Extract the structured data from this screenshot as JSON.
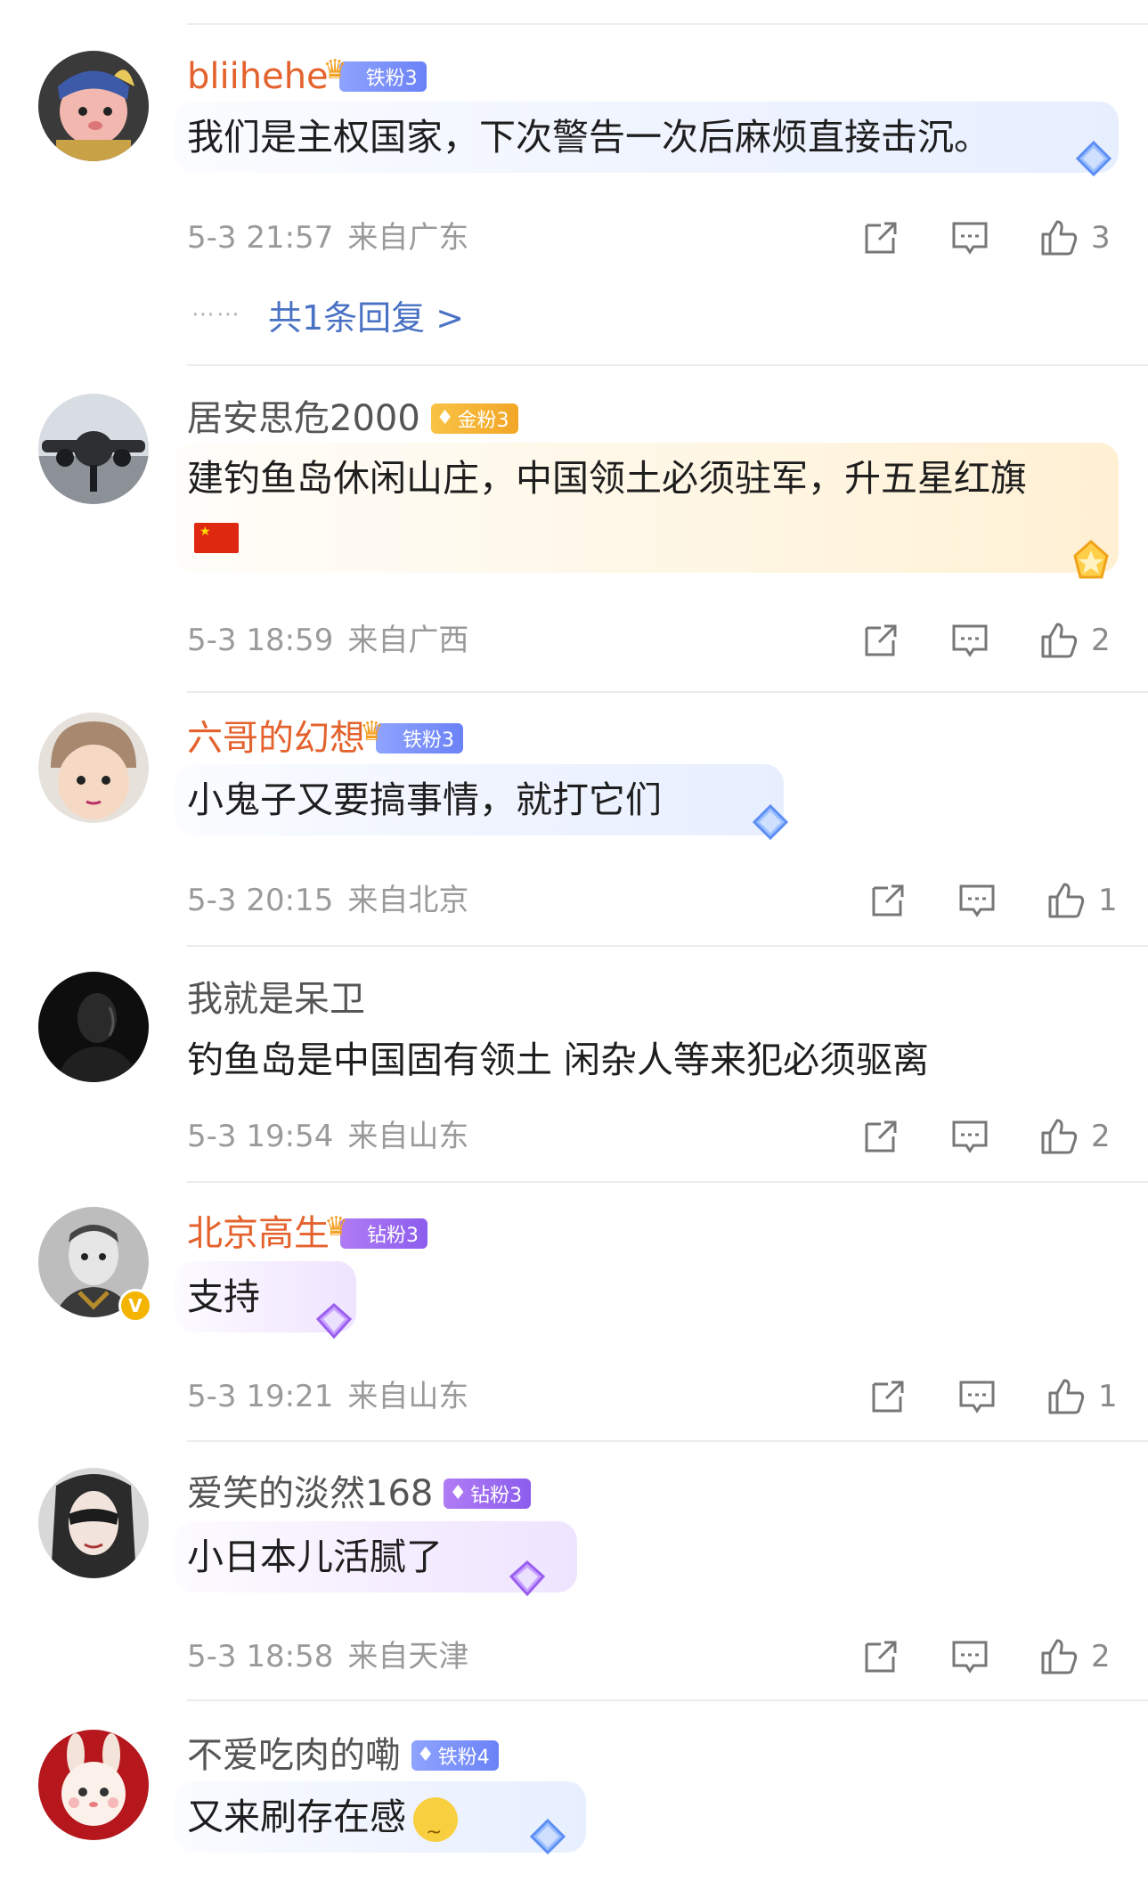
{
  "comments": [
    {
      "username": "bliihehe",
      "badge": "铁粉3",
      "badge_icon": "crown-icon",
      "text": "我们是主权国家，下次警告一次后麻烦直接击沉。",
      "time": "5-3 21:57",
      "location": "来自广东",
      "likes": "3",
      "replies": "共1条回复 >"
    },
    {
      "username": "居安思危2000",
      "badge": "金粉3",
      "text": "建钓鱼岛休闲山庄，中国领土必须驻军，升五星红旗",
      "time": "5-3 18:59",
      "location": "来自广西",
      "likes": "2"
    },
    {
      "username": "六哥的幻想",
      "badge": "铁粉3",
      "text": "小鬼子又要搞事情，就打它们",
      "time": "5-3 20:15",
      "location": "来自北京",
      "likes": "1"
    },
    {
      "username": "我就是呆卫",
      "text": "钓鱼岛是中国固有领土 闲杂人等来犯必须驱离",
      "time": "5-3 19:54",
      "location": "来自山东",
      "likes": "2"
    },
    {
      "username": "北京高生",
      "badge": "钻粉3",
      "verified": "V",
      "text": "支持",
      "time": "5-3 19:21",
      "location": "来自山东",
      "likes": "1"
    },
    {
      "username": "爱笑的淡然168",
      "badge": "钻粉3",
      "text": "小日本儿活腻了",
      "time": "5-3 18:58",
      "location": "来自天津",
      "likes": "2"
    },
    {
      "username": "不爱吃肉的嘞",
      "badge": "铁粉4",
      "text": "又来刷存在感",
      "time": "",
      "location": "",
      "likes": ""
    }
  ],
  "icons": {
    "share": "share-icon",
    "comment": "comment-icon",
    "like": "thumbs-up-icon"
  },
  "colors": {
    "orange_name": "#e4622d",
    "reply_link": "#4a72c4",
    "meta": "#9a9a9a"
  }
}
